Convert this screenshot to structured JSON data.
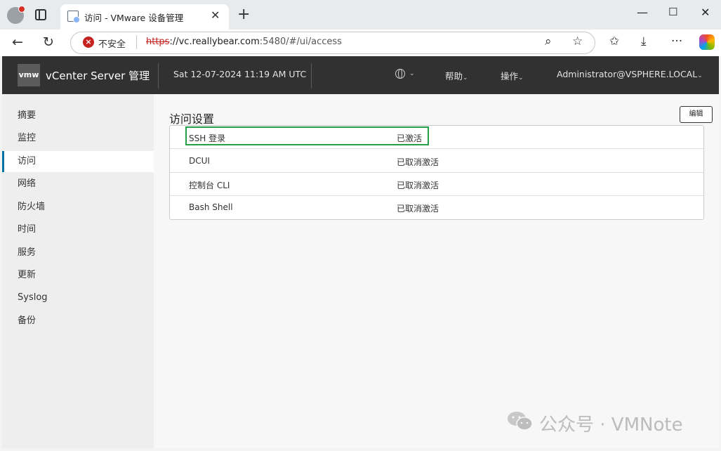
{
  "browser": {
    "tab_title": "访问 - VMware 设备管理",
    "security_label": "不安全",
    "url_proto": "https",
    "url_host": "://vc.reallybear.com",
    "url_rest": ":5480/#/ui/access"
  },
  "header": {
    "logo": "vmw",
    "app_title": "vCenter Server 管理",
    "datetime": "Sat 12-07-2024 11:19 AM UTC",
    "help": "帮助",
    "actions": "操作",
    "user": "Administrator@VSPHERE.LOCAL"
  },
  "sidebar": {
    "items": [
      {
        "label": "摘要"
      },
      {
        "label": "监控"
      },
      {
        "label": "访问"
      },
      {
        "label": "网络"
      },
      {
        "label": "防火墙"
      },
      {
        "label": "时间"
      },
      {
        "label": "服务"
      },
      {
        "label": "更新"
      },
      {
        "label": "Syslog"
      },
      {
        "label": "备份"
      }
    ],
    "active_index": 2
  },
  "main": {
    "title": "访问设置",
    "edit_label": "编辑",
    "rows": [
      {
        "name": "SSH 登录",
        "status": "已激活"
      },
      {
        "name": "DCUI",
        "status": "已取消激活"
      },
      {
        "name": "控制台 CLI",
        "status": "已取消激活"
      },
      {
        "name": "Bash Shell",
        "status": "已取消激活"
      }
    ]
  },
  "watermark": {
    "text": "公众号 · VMNote"
  },
  "colors": {
    "header_bg": "#313131",
    "active_accent": "#0072a3",
    "highlight": "#24a148"
  }
}
